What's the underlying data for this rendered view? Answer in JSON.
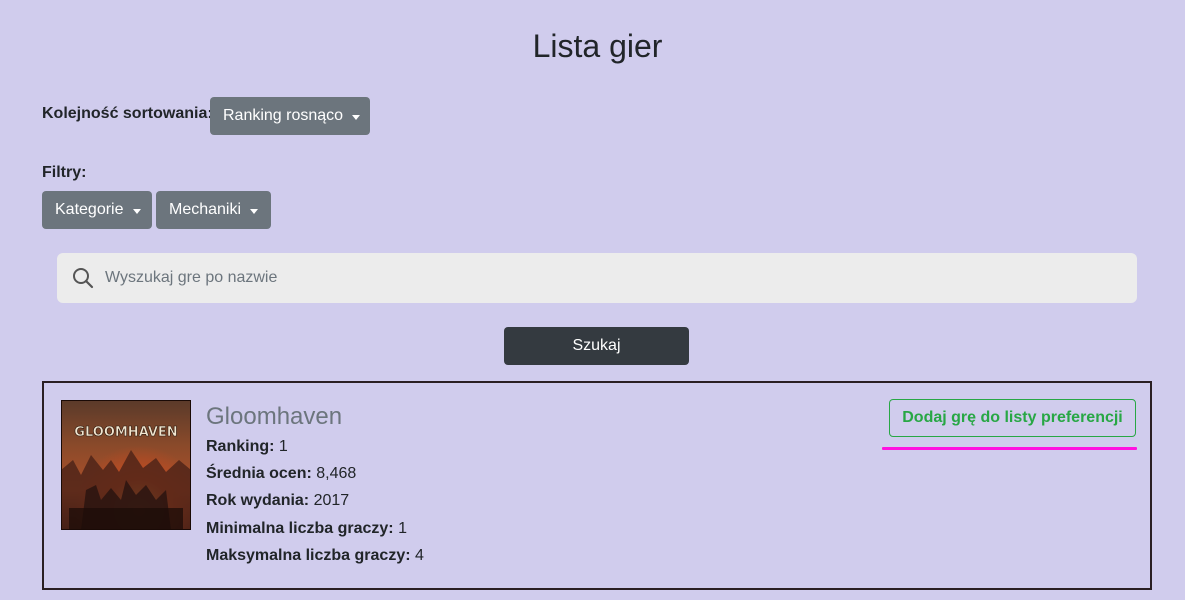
{
  "header": {
    "title": "Lista gier"
  },
  "sorting": {
    "label": "Kolejność sortowania:",
    "selected": "Ranking rosnąco"
  },
  "filters": {
    "label": "Filtry:",
    "categories_label": "Kategorie",
    "mechanics_label": "Mechaniki"
  },
  "search": {
    "placeholder": "Wyszukaj gre po nazwie",
    "value": "",
    "button_label": "Szukaj"
  },
  "games": [
    {
      "title": "Gloomhaven",
      "cover_text": "GLOOMHAVEN",
      "ranking_label": "Ranking:",
      "ranking": "1",
      "avg_label": "Średnia ocen:",
      "avg": "8,468",
      "year_label": "Rok wydania:",
      "year": "2017",
      "min_label": "Minimalna liczba graczy:",
      "min_players": "1",
      "max_label": "Maksymalna liczba graczy:",
      "max_players": "4",
      "add_label": "Dodaj grę do listy preferencji"
    }
  ],
  "colors": {
    "background": "#d0cced",
    "secondary_button": "#6c757d",
    "dark_button": "#343a40",
    "success": "#28a745",
    "highlight": "#ff11e0"
  }
}
